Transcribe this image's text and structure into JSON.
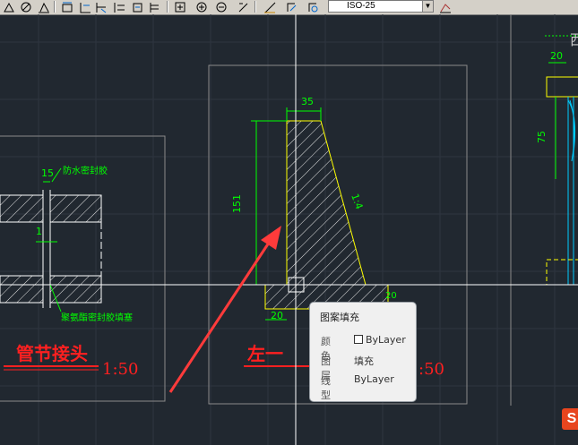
{
  "toolbar": {
    "dim_style_value": "ISO-25",
    "tools": [
      "osnap-icon",
      "ortho-icon",
      "dim-radius-icon",
      "dim-angular-icon",
      "dim-linear-icon",
      "dim-aligned-icon",
      "dim-ordinate-icon",
      "dim-baseline-icon",
      "dim-continue-icon",
      "tolerance-icon",
      "center-mark-icon",
      "dim-edit-icon",
      "dim-text-edit-icon",
      "dim-update-icon",
      "layer-icon"
    ]
  },
  "drawing": {
    "left_view": {
      "title": "管节接头",
      "scale": "1:50",
      "dim_top": "15",
      "dim_side": "1",
      "note_top": "防水密封胶",
      "note_bottom": "聚氨酯密封胶填塞"
    },
    "middle_view": {
      "title_partial": "左一",
      "scale_partial": ":50",
      "dim_top": "35",
      "dim_height": "151",
      "dim_slope": "1:4",
      "dim_bottom": "20",
      "dim_right": "20"
    },
    "right_view": {
      "title_partial": "西",
      "dim_top": "20",
      "dim_side": "75"
    }
  },
  "tooltip": {
    "title": "图案填充",
    "rows": [
      {
        "key": "颜色",
        "value": "ByLayer",
        "swatch": true
      },
      {
        "key": "图层",
        "value": "填充"
      },
      {
        "key": "线型",
        "value": "ByLayer"
      }
    ]
  },
  "watermark": {
    "logo_text": "S"
  },
  "colors": {
    "background": "#212830",
    "dimension": "#00ff00",
    "hatch": "#ffffff",
    "outline": "#ffff00",
    "title": "#ff2020",
    "arrow": "#ff3b3b",
    "viewport": "#808080",
    "crosshair": "#ffffff"
  }
}
